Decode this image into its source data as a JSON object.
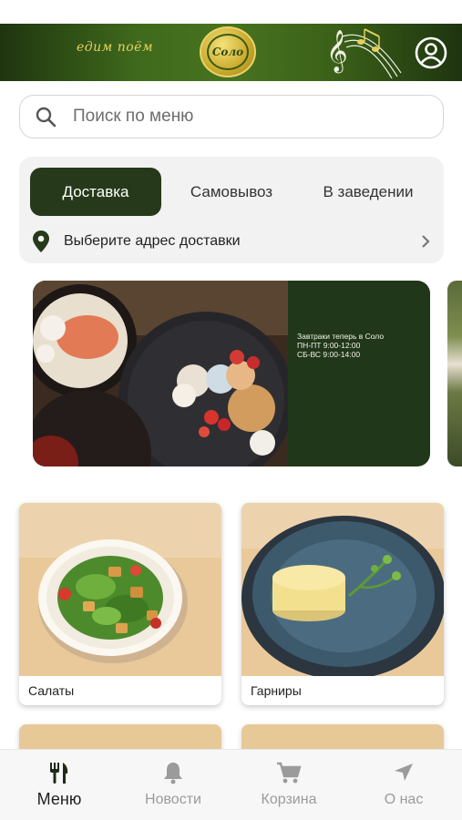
{
  "header": {
    "slogan": "едим поём",
    "logo_text": "Соло",
    "account_icon": "account-circle-icon",
    "music_icon": "treble-clef-icon"
  },
  "search": {
    "placeholder": "Поиск по меню",
    "icon": "search-icon"
  },
  "order_panel": {
    "tabs": [
      {
        "label": "Доставка",
        "active": true
      },
      {
        "label": "Самовывоз",
        "active": false
      },
      {
        "label": "В заведении",
        "active": false
      }
    ],
    "address_prompt": "Выберите адрес доставки",
    "address_icon": "map-pin-icon"
  },
  "banner": {
    "text": "Завтраки теперь в Соло\nПН-ПТ 9:00-12:00\nСБ-ВС 9:00-14:00"
  },
  "categories": [
    {
      "label": "Салаты"
    },
    {
      "label": "Гарниры"
    }
  ],
  "bottom_nav": {
    "items": [
      {
        "label": "Меню",
        "icon": "fork-knife-icon",
        "active": true
      },
      {
        "label": "Новости",
        "icon": "bell-icon",
        "active": false
      },
      {
        "label": "Корзина",
        "icon": "cart-icon",
        "active": false
      },
      {
        "label": "О нас",
        "icon": "navigation-arrow-icon",
        "active": false
      }
    ]
  },
  "colors": {
    "brand_green": "#26391a",
    "header_green": "#47731f",
    "gold": "#e4d15a"
  }
}
